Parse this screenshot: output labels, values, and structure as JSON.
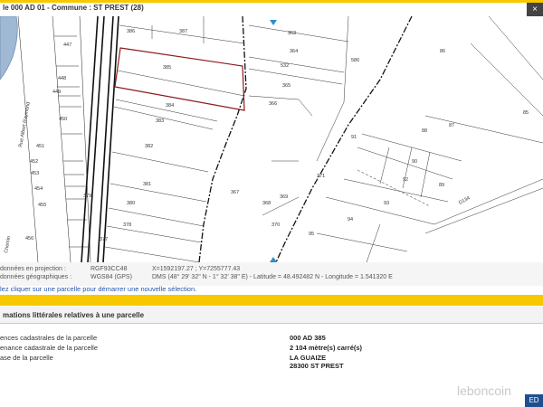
{
  "window": {
    "title": "le 000 AD 01 - Commune : ST PREST (28)",
    "close_label": "×"
  },
  "map": {
    "street_label": "Rue Albert Raymond",
    "street_label_2": "Chemin",
    "road_label": "D134",
    "parcels": {
      "left": [
        "447",
        "448",
        "449",
        "450",
        "451",
        "452",
        "453",
        "454",
        "455",
        "456"
      ],
      "center": [
        "386",
        "387",
        "385",
        "384",
        "383",
        "382",
        "381",
        "380",
        "379",
        "378",
        "377"
      ],
      "right": [
        "363",
        "364",
        "532",
        "365",
        "366",
        "367",
        "586",
        "86",
        "85",
        "87",
        "88",
        "90",
        "89",
        "91",
        "92",
        "93",
        "94",
        "95",
        "368",
        "369",
        "370",
        "371"
      ]
    }
  },
  "coords": {
    "proj_label": "données en projection :",
    "proj_system": "RGF93CC48",
    "proj_value": "X=1592197.27 ; Y=7255777.43",
    "geo_label": "données géographiques :",
    "geo_system": "WGS84 (GPS)",
    "geo_value": "DMS (48° 29' 32\" N - 1° 32' 38\" E) - Latitude = 48.492482 N - Longitude = 1.541320 E"
  },
  "hint": "lez cliquer sur une parcelle pour démarrer une nouvelle sélection.",
  "section": {
    "title": "mations littérales relatives à une parcelle"
  },
  "rows": [
    {
      "label": "ences cadastrales de la parcelle",
      "value": "000 AD 385"
    },
    {
      "label": "enance cadastrale de la parcelle",
      "value": "2 104 mètre(s) carré(s)"
    },
    {
      "label": "ase de la parcelle",
      "value": "LA GUAIZE"
    },
    {
      "label": "",
      "value": "28300 ST PREST"
    }
  ],
  "watermark": "leboncoin",
  "edit_button": "ED",
  "colors": {
    "accent": "#f7c800",
    "selection": "#8b1a1a",
    "hint": "#2255aa"
  }
}
